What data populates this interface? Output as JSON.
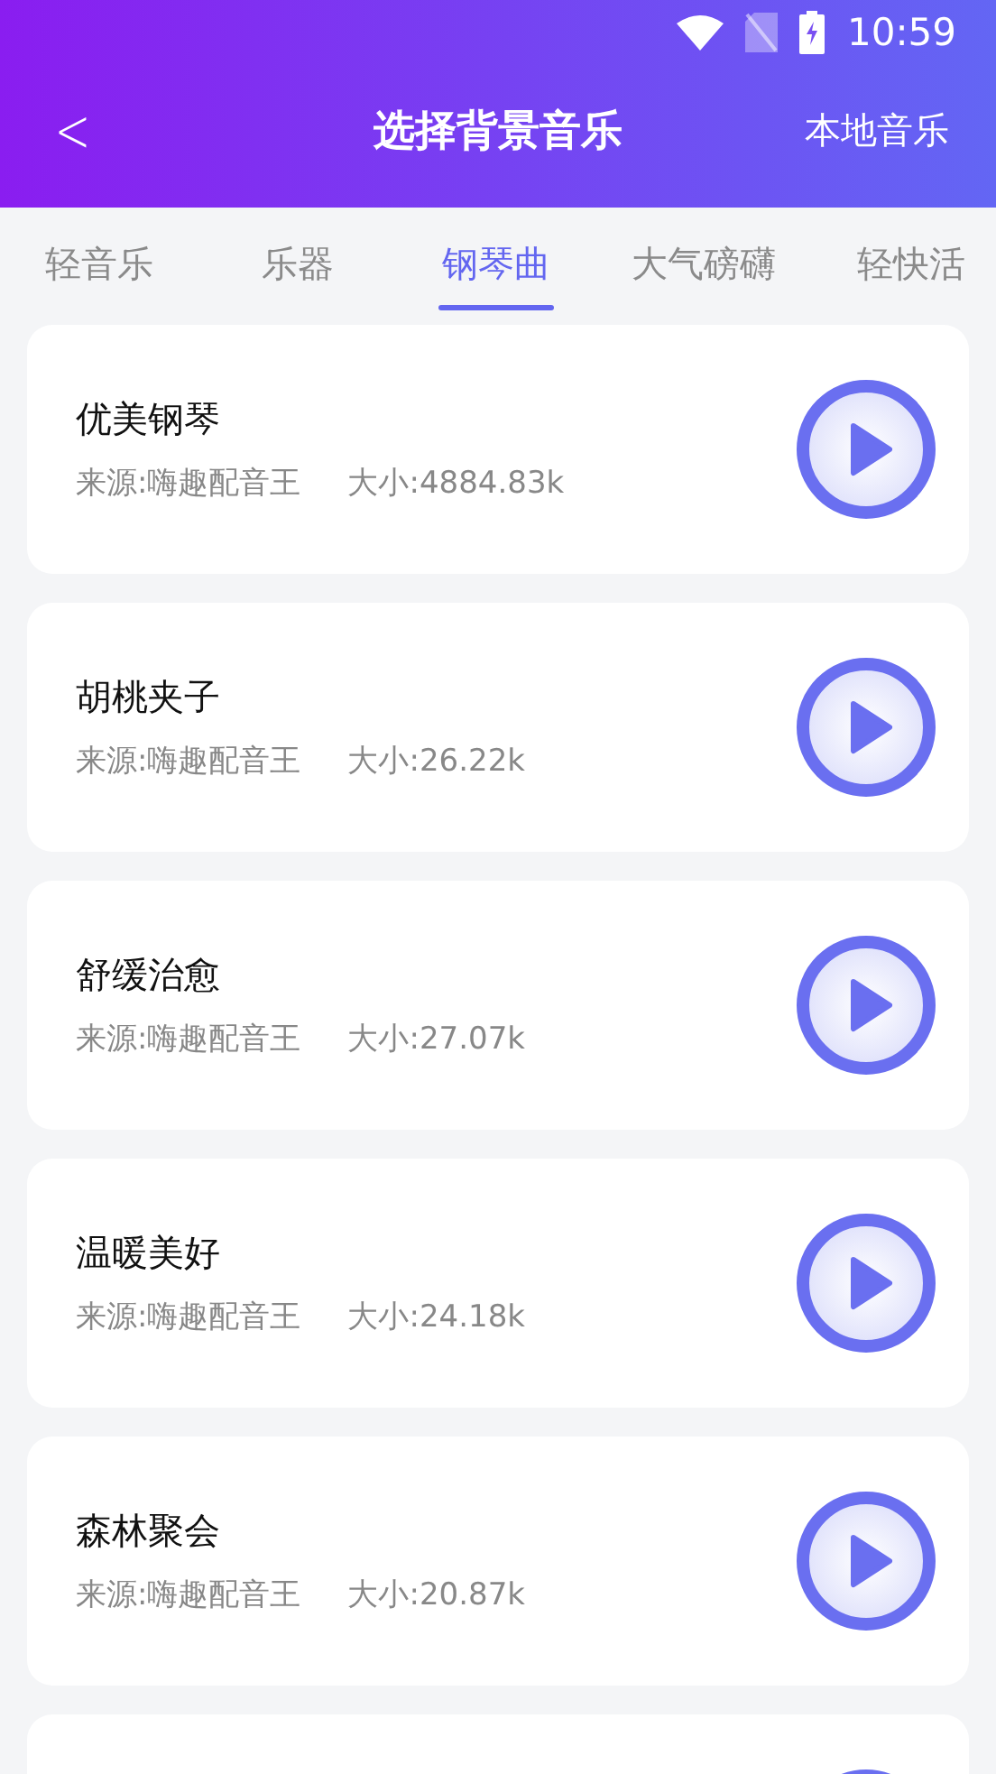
{
  "status_bar": {
    "time": "10:59"
  },
  "header": {
    "back": "<",
    "title": "选择背景音乐",
    "action": "本地音乐"
  },
  "tabs": [
    {
      "label": "轻音乐",
      "selected": false
    },
    {
      "label": "乐器",
      "selected": false
    },
    {
      "label": "钢琴曲",
      "selected": true
    },
    {
      "label": "大气磅礴",
      "selected": false
    },
    {
      "label": "轻快活",
      "selected": false
    }
  ],
  "tracks": [
    {
      "title": "优美钢琴",
      "source": "来源:嗨趣配音王",
      "size": "大小:4884.83k"
    },
    {
      "title": "胡桃夹子",
      "source": "来源:嗨趣配音王",
      "size": "大小:26.22k"
    },
    {
      "title": "舒缓治愈",
      "source": "来源:嗨趣配音王",
      "size": "大小:27.07k"
    },
    {
      "title": "温暖美好",
      "source": "来源:嗨趣配音王",
      "size": "大小:24.18k"
    },
    {
      "title": "森林聚会",
      "source": "来源:嗨趣配音王",
      "size": "大小:20.87k"
    }
  ]
}
